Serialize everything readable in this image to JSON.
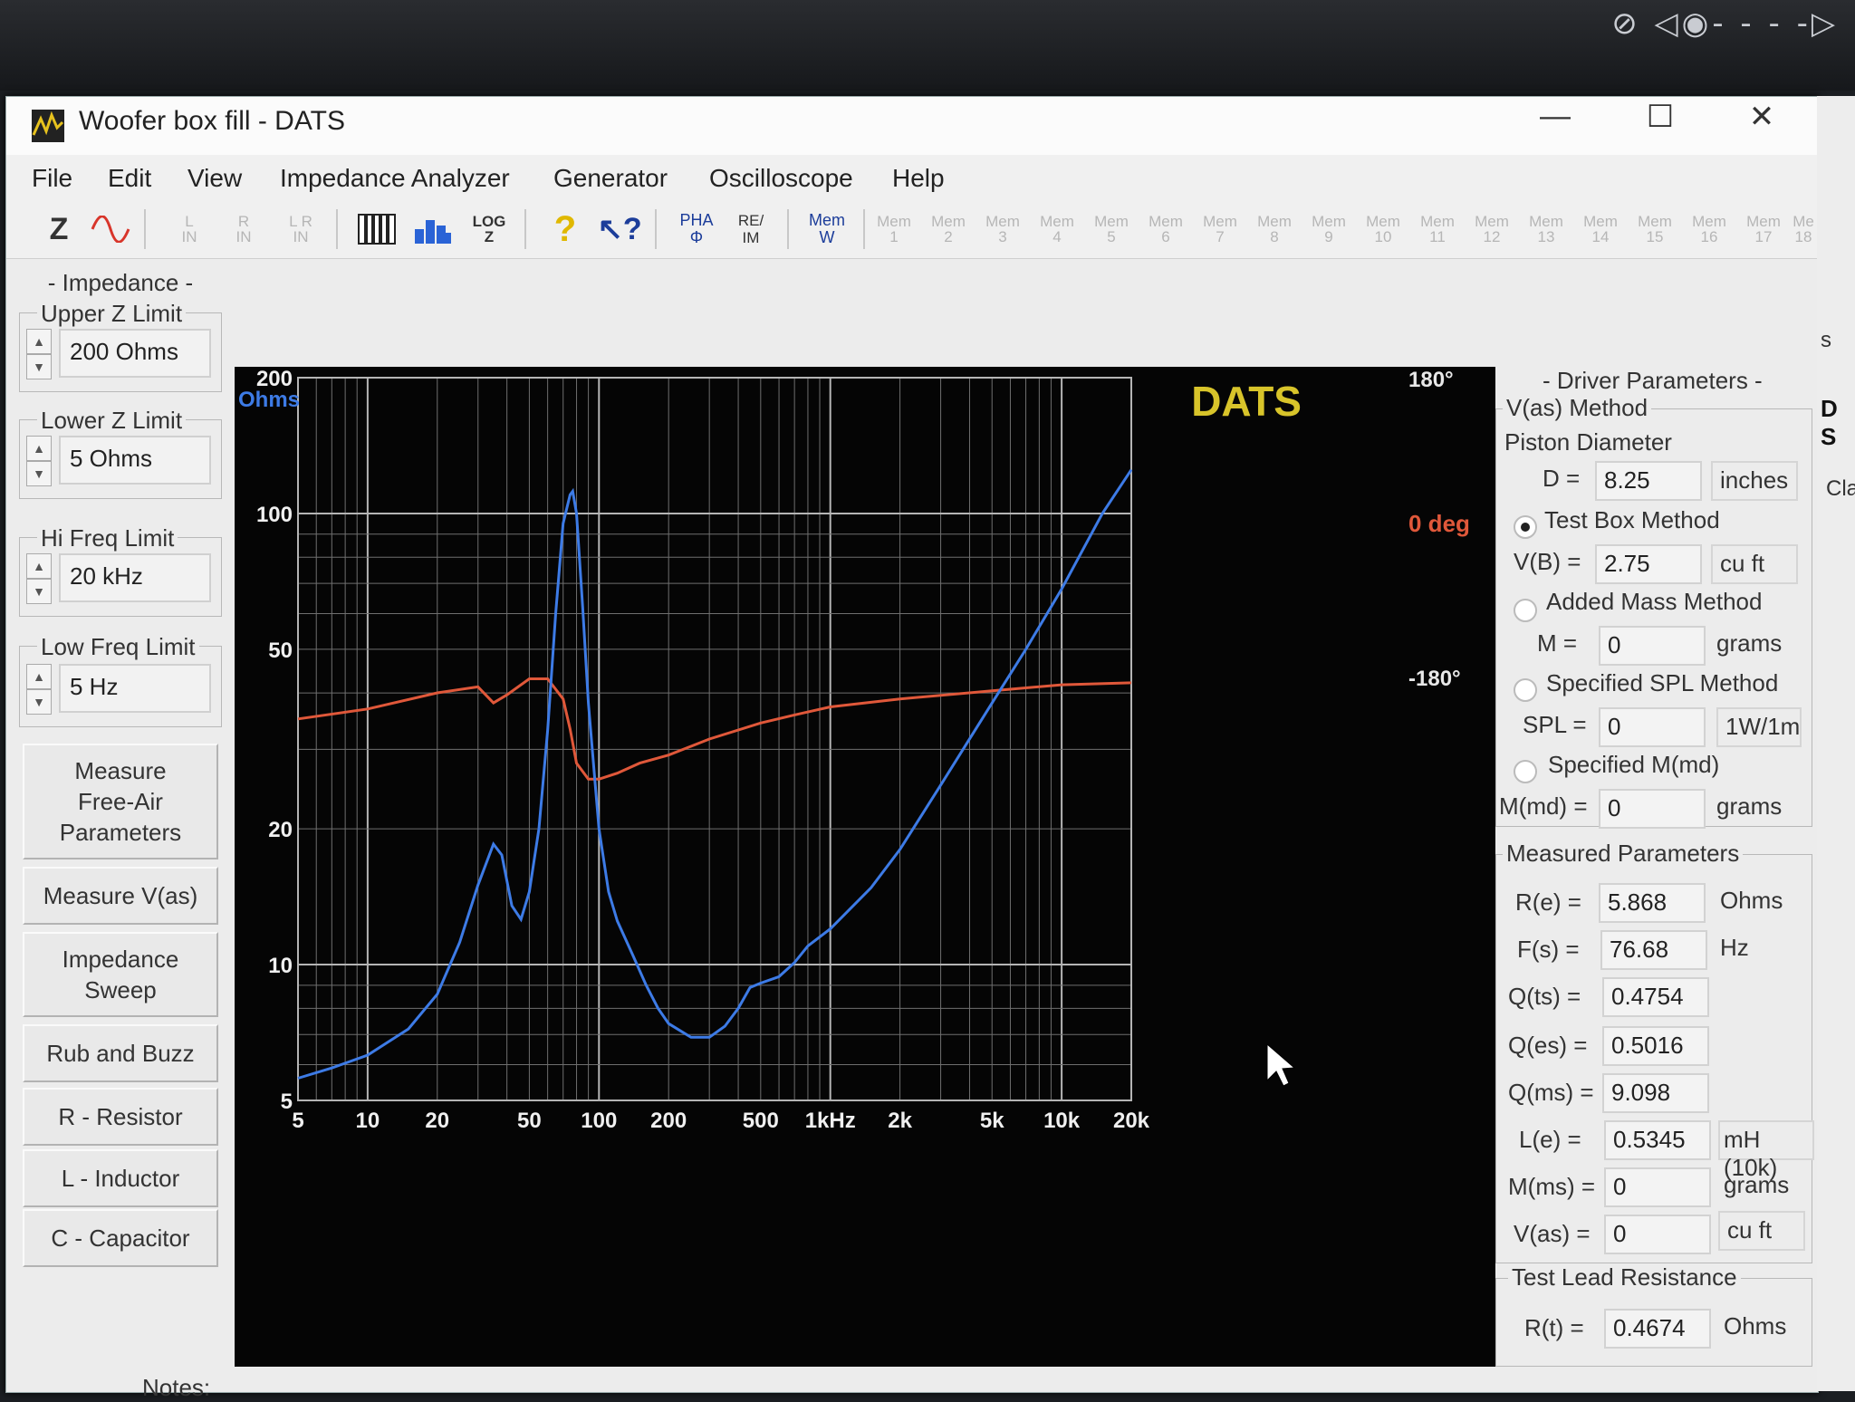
{
  "overlay": {
    "icons": "camera-off, target, arrow"
  },
  "window": {
    "title": "Woofer box fill - DATS",
    "minimize": "—",
    "maximize": "☐",
    "close": "✕"
  },
  "menu": [
    "File",
    "Edit",
    "View",
    "Impedance Analyzer",
    "Generator",
    "Oscilloscope",
    "Help"
  ],
  "toolbar": {
    "z": "Z",
    "l_in": "L\nIN",
    "r_in": "R\nIN",
    "lr_in": "L R\nIN",
    "log_z": "LOG\nZ",
    "pha": "PHA\nΦ",
    "reim": "RE/\nIM",
    "mem_w": "Mem\nW",
    "mems": [
      "Mem\n1",
      "Mem\n2",
      "Mem\n3",
      "Mem\n4",
      "Mem\n5",
      "Mem\n6",
      "Mem\n7",
      "Mem\n8",
      "Mem\n9",
      "Mem\n10",
      "Mem\n11",
      "Mem\n12",
      "Mem\n13",
      "Mem\n14",
      "Mem\n15",
      "Mem\n16",
      "Mem\n17",
      "Me\n18"
    ]
  },
  "left": {
    "impedance_header": "- Impedance -",
    "upper_label": "Upper Z Limit",
    "upper_value": "200 Ohms",
    "lower_label": "Lower Z Limit",
    "lower_value": "5 Ohms",
    "hi_label": "Hi Freq Limit",
    "hi_value": "20 kHz",
    "low_label": "Low Freq Limit",
    "low_value": "5 Hz",
    "buttons": [
      "Measure\nFree-Air\nParameters",
      "Measure V(as)",
      "Impedance\nSweep",
      "Rub and Buzz",
      "R - Resistor",
      "L - Inductor",
      "C - Capacitor"
    ],
    "notes": "Notes:"
  },
  "chart_data": {
    "type": "line",
    "brand": "DATS",
    "y_unit": "Ohms",
    "y_scale": "log",
    "ylim": [
      5,
      200
    ],
    "y_ticks": [
      200,
      100,
      50,
      20,
      10,
      5
    ],
    "x_scale": "log",
    "xlim": [
      5,
      20000
    ],
    "x_tick_labels": [
      "5",
      "10",
      "20",
      "50",
      "100",
      "200",
      "500",
      "1kHz",
      "2k",
      "5k",
      "10k",
      "20k"
    ],
    "x_tick_values": [
      5,
      10,
      20,
      50,
      100,
      200,
      500,
      1000,
      2000,
      5000,
      10000,
      20000
    ],
    "phase_labels": {
      "top": "180°",
      "mid": "0 deg",
      "bottom": "-180°"
    },
    "phase_lim": [
      -180,
      180
    ],
    "colors": {
      "impedance": "#3d7be6",
      "phase": "#e0583a",
      "brand": "#d8c42a",
      "grid": "#8c8c8c",
      "bg": "#050505"
    },
    "series": [
      {
        "name": "Impedance",
        "x": [
          5,
          7,
          10,
          15,
          20,
          25,
          30,
          35,
          38,
          42,
          46,
          50,
          55,
          60,
          65,
          70,
          75,
          77,
          80,
          85,
          90,
          100,
          110,
          120,
          140,
          160,
          180,
          200,
          250,
          300,
          350,
          400,
          450,
          500,
          600,
          700,
          800,
          1000,
          1500,
          2000,
          3000,
          5000,
          7000,
          10000,
          15000,
          20000
        ],
        "values": [
          5.6,
          5.9,
          6.3,
          7.2,
          8.6,
          11.2,
          15.0,
          18.5,
          17.5,
          13.5,
          12.6,
          14.5,
          20.0,
          33.0,
          60.0,
          95.0,
          110.0,
          112.0,
          100.0,
          62.0,
          38.0,
          20.0,
          14.5,
          12.5,
          10.5,
          9.0,
          8.0,
          7.4,
          6.9,
          6.9,
          7.3,
          8.0,
          8.9,
          9.1,
          9.4,
          10.1,
          11.0,
          12.0,
          14.8,
          18.0,
          25.0,
          38.0,
          50.0,
          68.0,
          100.0,
          125.0
        ]
      },
      {
        "name": "Phase",
        "x": [
          5,
          10,
          20,
          30,
          35,
          40,
          50,
          60,
          70,
          75,
          80,
          90,
          100,
          120,
          150,
          200,
          300,
          500,
          700,
          1000,
          2000,
          5000,
          10000,
          20000
        ],
        "values": [
          10,
          15,
          23,
          26,
          18,
          22,
          30,
          30,
          20,
          5,
          -12,
          -20,
          -20,
          -17,
          -12,
          -8,
          0,
          8,
          12,
          16,
          20,
          24,
          27,
          28
        ]
      }
    ]
  },
  "right": {
    "driver_header": "- Driver Parameters -",
    "vas_method": "V(as) Method",
    "piston_label": "Piston Diameter",
    "d_label": "D =",
    "d_value": "8.25",
    "d_unit": "inches",
    "test_box": "Test Box Method",
    "vb_label": "V(B) =",
    "vb_value": "2.75",
    "vb_unit": "cu ft",
    "added_mass": "Added Mass Method",
    "m_label": "M =",
    "m_value": "0",
    "m_unit": "grams",
    "spl_method": "Specified SPL Method",
    "spl_label": "SPL =",
    "spl_value": "0",
    "spl_unit": "1W/1m",
    "mmd_method": "Specified M(md)",
    "mmd_label": "M(md) =",
    "mmd_value": "0",
    "mmd_unit": "grams",
    "measured_header": "Measured Parameters",
    "params": [
      {
        "label": "R(e) =",
        "value": "5.868",
        "unit": "Ohms"
      },
      {
        "label": "F(s) =",
        "value": "76.68",
        "unit": "Hz"
      },
      {
        "label": "Q(ts) =",
        "value": "0.4754",
        "unit": ""
      },
      {
        "label": "Q(es) =",
        "value": "0.5016",
        "unit": ""
      },
      {
        "label": "Q(ms) =",
        "value": "9.098",
        "unit": ""
      },
      {
        "label": "L(e) =",
        "value": "0.5345",
        "unit": "mH (10k)"
      },
      {
        "label": "M(ms) =",
        "value": "0",
        "unit": "grams"
      },
      {
        "label": "V(as) =",
        "value": "0",
        "unit": "cu ft"
      }
    ],
    "lead_header": "Test Lead Resistance",
    "rt_label": "R(t) =",
    "rt_value": "0.4674",
    "rt_unit": "Ohms"
  },
  "behind": {
    "s1": "s",
    "s2": "D S",
    "s3": "Cla"
  }
}
